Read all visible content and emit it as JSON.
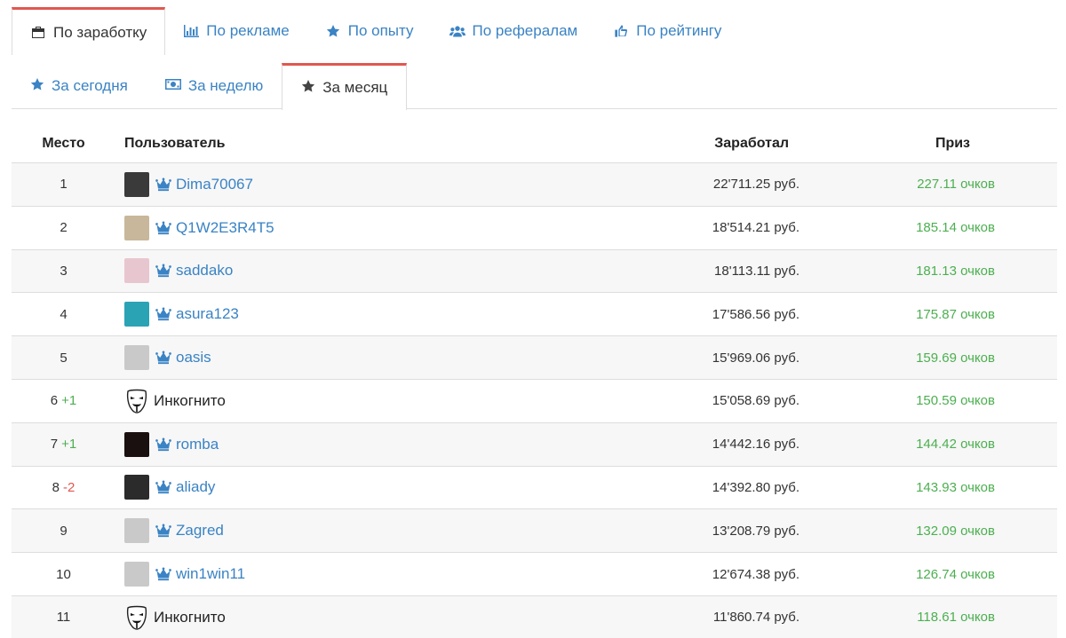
{
  "tabs_top": [
    {
      "label": "По заработку",
      "icon": "briefcase-icon",
      "active": true
    },
    {
      "label": "По рекламе",
      "icon": "bar-chart-icon",
      "active": false
    },
    {
      "label": "По опыту",
      "icon": "star-icon",
      "active": false
    },
    {
      "label": "По рефералам",
      "icon": "users-icon",
      "active": false
    },
    {
      "label": "По рейтингу",
      "icon": "thumbs-up-icon",
      "active": false
    }
  ],
  "tabs_sub": [
    {
      "label": "За сегодня",
      "icon": "star-icon",
      "active": false
    },
    {
      "label": "За неделю",
      "icon": "money-icon",
      "active": false
    },
    {
      "label": "За месяц",
      "icon": "star-icon",
      "active": true
    }
  ],
  "table": {
    "headers": {
      "place": "Место",
      "user": "Пользователь",
      "earned": "Заработал",
      "prize": "Приз"
    },
    "rows": [
      {
        "place": "1",
        "delta": "",
        "user": "Dima70067",
        "incognito": false,
        "earned": "22'711.25 руб.",
        "prize": "227.11 очков",
        "avatar": "#3a3a3a"
      },
      {
        "place": "2",
        "delta": "",
        "user": "Q1W2E3R4T5",
        "incognito": false,
        "earned": "18'514.21 руб.",
        "prize": "185.14 очков",
        "avatar": "#c8b79a"
      },
      {
        "place": "3",
        "delta": "",
        "user": "saddako",
        "incognito": false,
        "earned": "18'113.11 руб.",
        "prize": "181.13 очков",
        "avatar": "#e8c6d0"
      },
      {
        "place": "4",
        "delta": "",
        "user": "asura123",
        "incognito": false,
        "earned": "17'586.56 руб.",
        "prize": "175.87 очков",
        "avatar": "#2aa3b5"
      },
      {
        "place": "5",
        "delta": "",
        "user": "oasis",
        "incognito": false,
        "earned": "15'969.06 руб.",
        "prize": "159.69 очков",
        "avatar": "#c9c9c9"
      },
      {
        "place": "6",
        "delta": "+1",
        "user": "Инкогнито",
        "incognito": true,
        "earned": "15'058.69 руб.",
        "prize": "150.59 очков",
        "avatar": ""
      },
      {
        "place": "7",
        "delta": "+1",
        "user": "romba",
        "incognito": false,
        "earned": "14'442.16 руб.",
        "prize": "144.42 очков",
        "avatar": "#1a1010"
      },
      {
        "place": "8",
        "delta": "-2",
        "user": "aliady",
        "incognito": false,
        "earned": "14'392.80 руб.",
        "prize": "143.93 очков",
        "avatar": "#2b2b2b"
      },
      {
        "place": "9",
        "delta": "",
        "user": "Zagred",
        "incognito": false,
        "earned": "13'208.79 руб.",
        "prize": "132.09 очков",
        "avatar": "#c9c9c9"
      },
      {
        "place": "10",
        "delta": "",
        "user": "win1win11",
        "incognito": false,
        "earned": "12'674.38 руб.",
        "prize": "126.74 очков",
        "avatar": "#c9c9c9"
      },
      {
        "place": "11",
        "delta": "",
        "user": "Инкогнито",
        "incognito": true,
        "earned": "11'860.74 руб.",
        "prize": "118.61 очков",
        "avatar": ""
      }
    ]
  }
}
